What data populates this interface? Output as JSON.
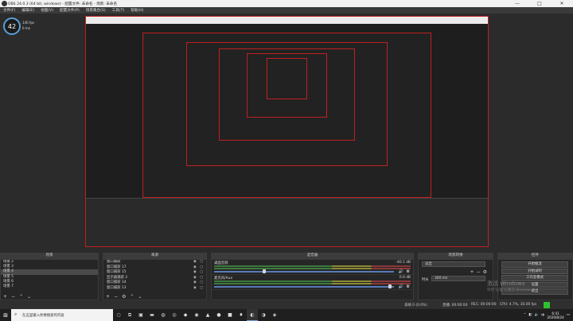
{
  "window": {
    "title": "OBS 24.0.3 (64 bit, windows) - 配置文件: 未命名 - 场景: 未命名",
    "min": "—",
    "max": "□",
    "close": "✕"
  },
  "menu": [
    "文件(F)",
    "编辑(E)",
    "视图(V)",
    "配置文件(P)",
    "场景集合(S)",
    "工具(T)",
    "帮助(H)"
  ],
  "overlay": {
    "gauge_value": "42",
    "line1": "140 fps",
    "line2": "0 ms"
  },
  "docks": {
    "scenes_title": "场景",
    "sources_title": "来源",
    "mixer_title": "混音器",
    "transitions_title": "场景转换",
    "controls_title": "控件"
  },
  "scenes": [
    "场景 2",
    "场景 3",
    "场景 4",
    "场景 5",
    "场景 6",
    "场景 7"
  ],
  "selected_scene_index": 2,
  "sources": [
    "窗口捕获",
    "窗口捕获 17",
    "窗口捕获 15",
    "显示器捕获 2",
    "窗口捕获 14",
    "窗口捕获 13"
  ],
  "mixer": [
    {
      "name": "桌面音频",
      "db": "-40.1 dB"
    },
    {
      "name": "麦克风/Aux",
      "db": "0.0 dB"
    }
  ],
  "transitions": {
    "selected": "淡出",
    "duration_label": "时长",
    "duration_value": "300 ms"
  },
  "controls": [
    "开始推流",
    "开始录制",
    "工作室模式",
    "设置",
    "退出"
  ],
  "status": {
    "live": "直播: 00:00:00",
    "rec": "REC: 00:00:00",
    "cpu": "CPU: 4.7%, 30.00 fps",
    "dropped": "丢帧 0 (0.0%)"
  },
  "taskbar": {
    "search_placeholder": "在这里输入你要搜索的内容",
    "time": "6:41",
    "date": "2020/8/24",
    "lang": "中"
  },
  "watermark": {
    "line1": "激活 Windows",
    "line2": "转到\"设置\"以激活 Windows。"
  },
  "colors": {
    "preview_border": "#c02020",
    "selection": "#4a4a4a",
    "accent": "#5a7bb8"
  }
}
